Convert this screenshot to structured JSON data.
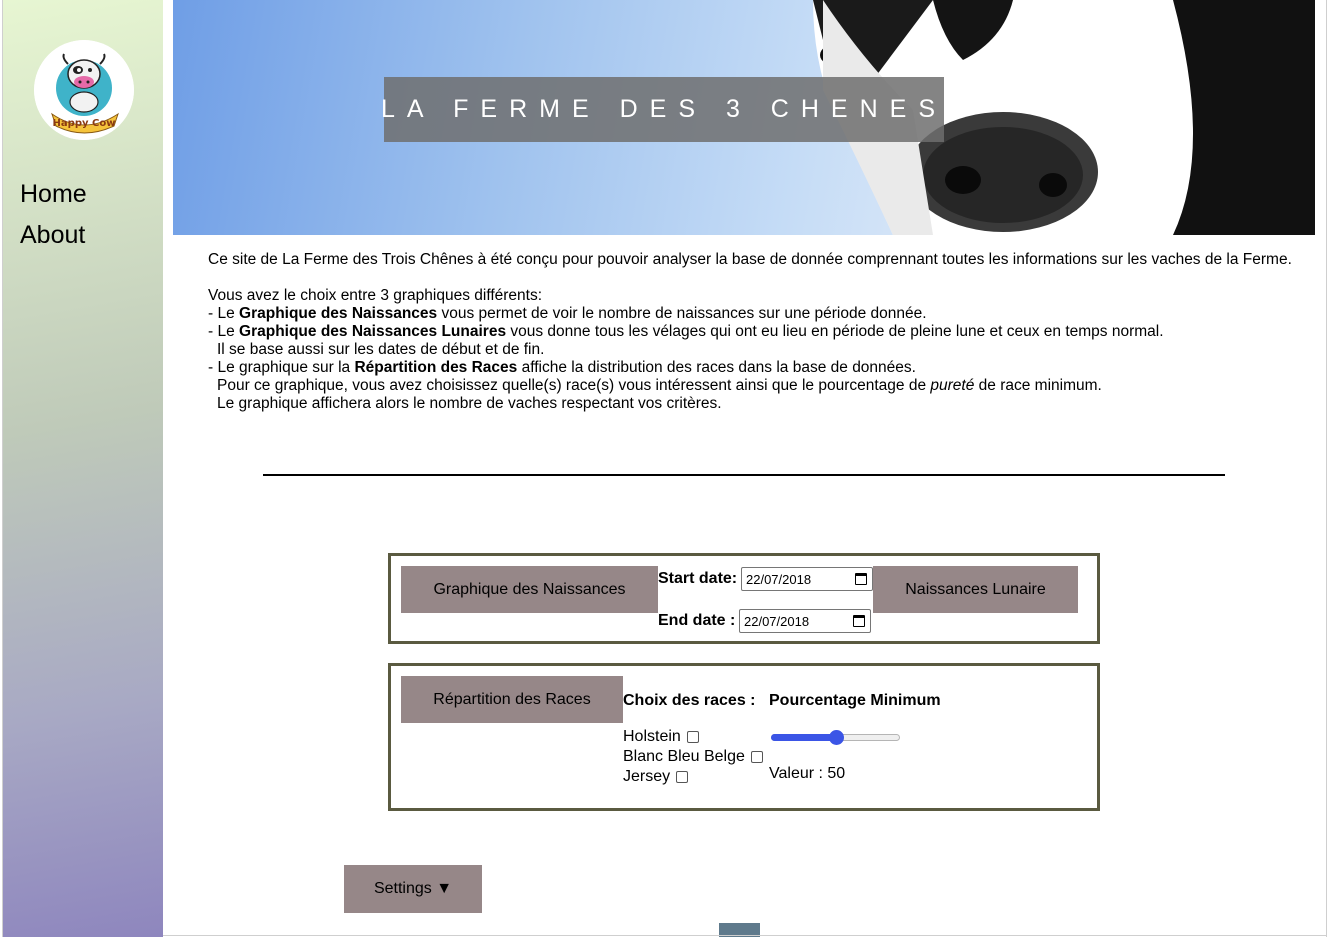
{
  "sidebar": {
    "logo_text": "Happy Cow",
    "nav": [
      {
        "label": "Home"
      },
      {
        "label": "About"
      }
    ]
  },
  "header": {
    "title": "LA FERME DES 3 CHENES"
  },
  "intro": {
    "line1": "Ce site de La Ferme des Trois Chênes à été conçu pour pouvoir analyser la base de donnée comprennant toutes les informations sur les vaches de la Ferme.",
    "choice": "Vous avez le choix entre 3 graphiques différents:",
    "b1_pre": "- Le ",
    "b1_bold": "Graphique des Naissances",
    "b1_post": " vous permet de voir le nombre de naissances sur une période donnée.",
    "b2_pre": "- Le ",
    "b2_bold": "Graphique des Naissances Lunaires",
    "b2_post": " vous donne tous les vélages qui ont eu lieu en période de pleine lune et ceux en temps normal.",
    "b2_sub": "Il se base aussi sur les dates de début et de fin.",
    "b3_pre": "- Le graphique sur la ",
    "b3_bold": "Répartition des Races",
    "b3_post": " affiche la distribution des races dans la base de données.",
    "b3_sub1_pre": "Pour ce graphique, vous avez choisissez quelle(s) race(s) vous intéressent ainsi que le pourcentage de ",
    "b3_sub1_em": "pureté",
    "b3_sub1_post": " de race minimum.",
    "b3_sub2": "Le graphique affichera alors le nombre de vaches respectant vos critères."
  },
  "panel_naissances": {
    "button_label": "Graphique des Naissances",
    "start_label": "Start date:",
    "start_value": "22/07/2018",
    "end_label": "End date :",
    "end_value": "22/07/2018",
    "lunaire_label": "Naissances Lunaire"
  },
  "panel_races": {
    "button_label": "Répartition des Races",
    "choix_label": "Choix des races :",
    "races": [
      {
        "label": "Holstein",
        "checked": false
      },
      {
        "label": "Blanc Bleu Belge",
        "checked": false
      },
      {
        "label": "Jersey",
        "checked": false
      }
    ],
    "pct_label": "Pourcentage Minimum",
    "slider_value": 50,
    "slider_max": 100,
    "valeur_text": "Valeur : 50",
    "accent_color": "#3b55e6"
  },
  "settings": {
    "label": "Settings ▼"
  }
}
